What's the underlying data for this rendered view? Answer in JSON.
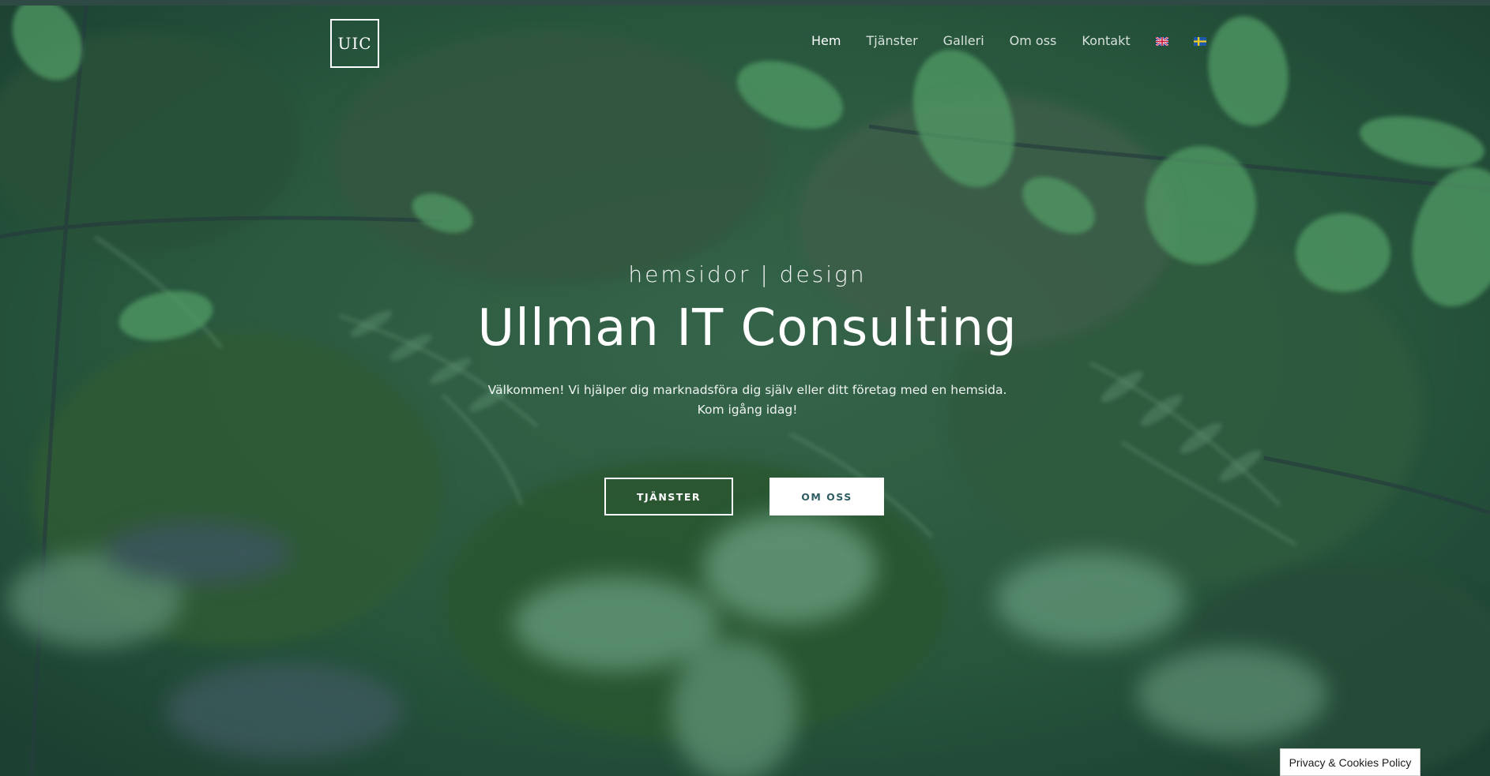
{
  "logo": {
    "text": "UIC"
  },
  "nav": {
    "items": [
      {
        "label": "Hem"
      },
      {
        "label": "Tjänster"
      },
      {
        "label": "Galleri"
      },
      {
        "label": "Om oss"
      },
      {
        "label": "Kontakt"
      }
    ],
    "languages": [
      {
        "icon": "uk-flag-icon"
      },
      {
        "icon": "sweden-flag-icon"
      }
    ]
  },
  "hero": {
    "tagline": "hemsidor | design",
    "title": "Ullman IT Consulting",
    "lead_line1": "Välkommen! Vi hjälper dig marknadsföra dig själv eller ditt företag med en hemsida.",
    "lead_line2": "Kom igång idag!",
    "button_services": "TJÄNSTER",
    "button_about": "OM OSS"
  },
  "cookie": {
    "label": "Privacy & Cookies Policy"
  },
  "colors": {
    "topbar": "#2f4a45",
    "button_solid_text": "#2e5e63",
    "foliage_dark": "#1f4a2f",
    "foliage_light": "#5fae6a"
  }
}
